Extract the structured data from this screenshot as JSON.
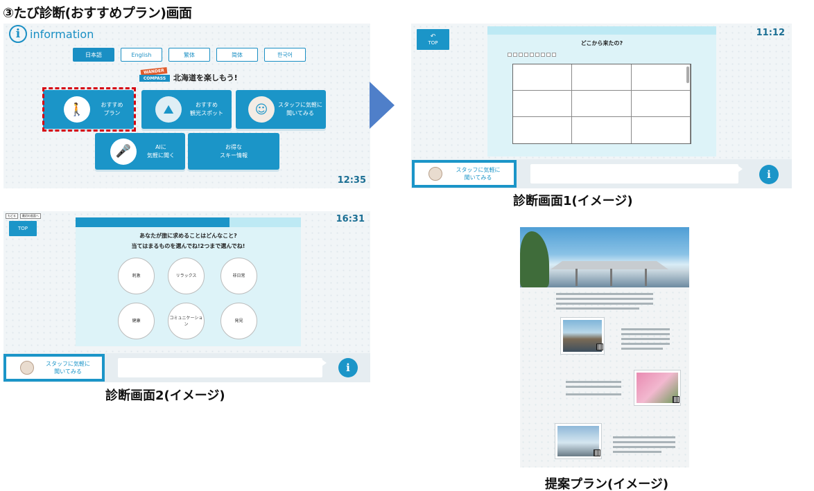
{
  "heading": "③たび診断(おすすめプラン)画面",
  "screen_top": {
    "logo_text": "information",
    "languages": [
      "日本語",
      "English",
      "繁体",
      "简体",
      "한국어"
    ],
    "brand_line1": "WANDER",
    "brand_line2": "COMPASS",
    "tagline": "北海道を楽しもう!",
    "buttons": [
      {
        "label": "おすすめ\nプラン"
      },
      {
        "label": "おすすめ\n観光スポット"
      },
      {
        "label": "スタッフに気軽に\n聞いてみる"
      },
      {
        "label": "AIに\n気軽に聞く"
      },
      {
        "label": "お得な\nスキー情報"
      }
    ],
    "clock_time": "12:35"
  },
  "screen_origin": {
    "top_label": "TOP",
    "clock_time": "11:12",
    "question": "どこから来たの?",
    "staff_button": "スタッフに気軽に\n聞いてみる",
    "info_glyph": "i"
  },
  "screen_pref": {
    "tags": [
      "もどる",
      "最初の画面へ"
    ],
    "top_label": "TOP",
    "clock_time": "16:31",
    "question": "あなたが旅に求めることはどんなこと?\n当てはまるものを選んでね!2つまで選んでね!",
    "choices": [
      "刺激",
      "リラックス",
      "非日常",
      "健康",
      "コミュニケーション",
      "発見"
    ],
    "staff_button": "スタッフに気軽に\n聞いてみる",
    "info_glyph": "i"
  },
  "captions": {
    "screen1": "診断画面1(イメージ)",
    "screen2": "診断画面2(イメージ)",
    "plan": "提案プラン(イメージ)"
  },
  "colors": {
    "accent": "#1b95c8",
    "highlight": "#d6000f",
    "arrow": "#4f7fc9"
  }
}
